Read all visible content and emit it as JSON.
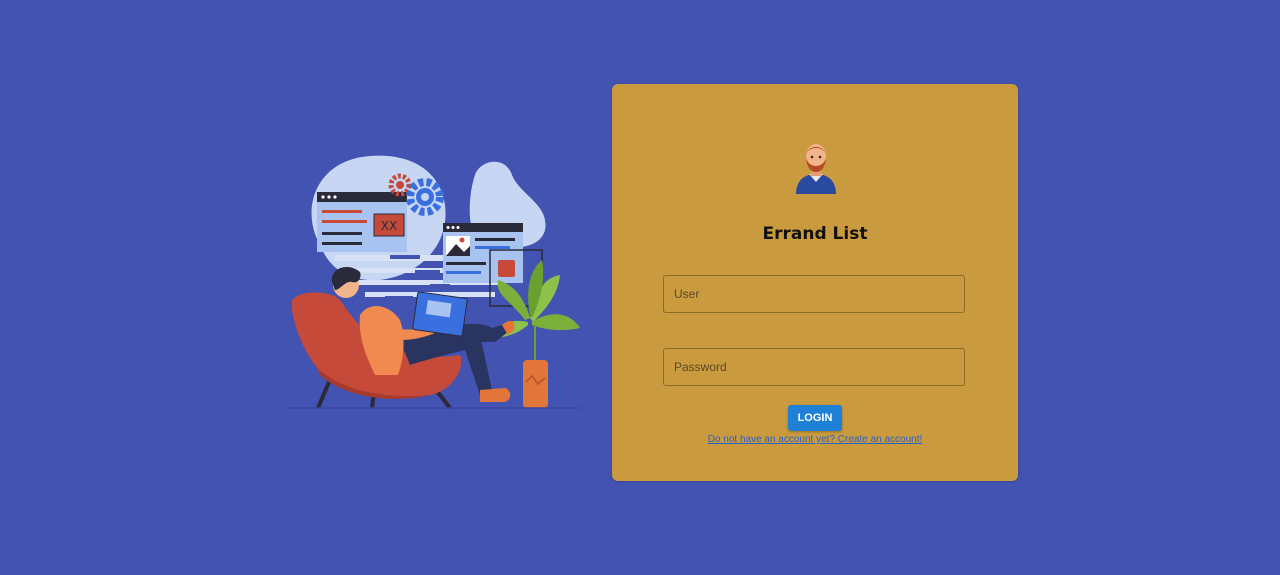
{
  "illustration": {
    "screen_text": "XX"
  },
  "login_card": {
    "title": "Errand List",
    "user_placeholder": "User",
    "password_placeholder": "Password",
    "login_label": "LOGIN",
    "signup_link": "Do not have an account yet? Create an account!"
  },
  "colors": {
    "background": "#4253b1",
    "card": "#c99a3e",
    "button": "#1f80d8",
    "link": "#2a62c8"
  },
  "icons": [
    "user-avatar-icon",
    "gear-icon",
    "plant-icon",
    "laptop-icon"
  ]
}
